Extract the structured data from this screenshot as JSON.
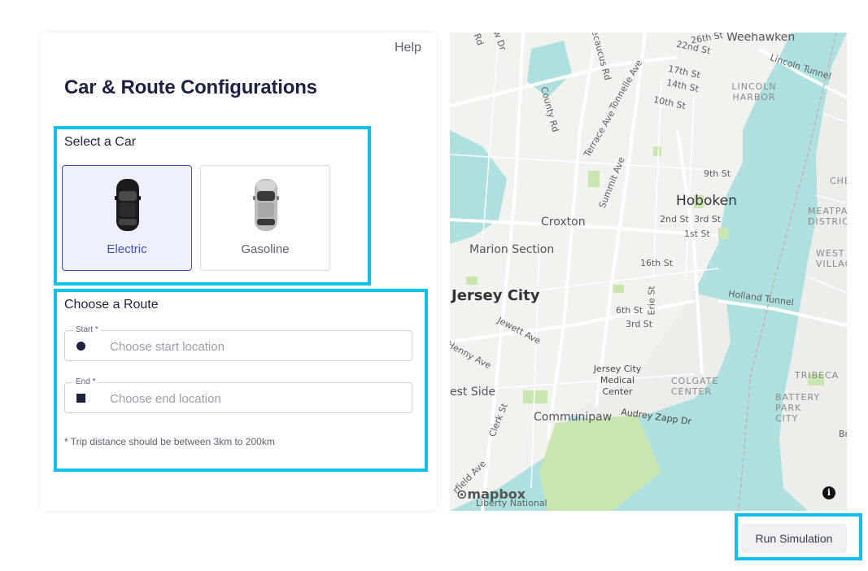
{
  "header": {
    "help_label": "Help",
    "title": "Car & Route Configurations"
  },
  "car_section": {
    "label": "Select a Car",
    "options": [
      {
        "name": "Electric",
        "selected": true
      },
      {
        "name": "Gasoline",
        "selected": false
      }
    ]
  },
  "route_section": {
    "label": "Choose a Route",
    "start": {
      "label": "Start *",
      "placeholder": "Choose start location",
      "value": ""
    },
    "end": {
      "label": "End *",
      "placeholder": "Choose end location",
      "value": ""
    },
    "note": "* Trip distance should be between 3km to 200km"
  },
  "map": {
    "labels": {
      "weehawken": "Weehawken",
      "lincoln_tunnel": "Lincoln Tunnel",
      "lincoln_harbor": "LINCOLN HARBOR",
      "hoboken": "Hoboken",
      "croxton": "Croxton",
      "marion_section": "Marion Section",
      "jersey_city": "Jersey City",
      "holland_tunnel": "Holland Tunnel",
      "meatpacking": "MEATPACKIN DISTRICT",
      "west_village": "WEST VILLAGI",
      "tribeca": "TRIBECA",
      "battery_park": "BATTERY PARK CITY",
      "colgate": "COLGATE CENTER",
      "medical_center": "Jersey City Medical Center",
      "communipaw": "Communipaw",
      "west_side": "est Side",
      "st_9th": "9th St",
      "st_2nd": "2nd St",
      "st_3rd": "3rd St",
      "st_1st": "1st St",
      "st_16th": "16th St",
      "st_6th": "6th St",
      "st_3rd_jc": "3rd St",
      "st_10th": "10th St",
      "st_14th": "14th St",
      "st_17th": "17th St",
      "st_22nd": "22nd St",
      "st_26th": "26th St",
      "summit_ave": "Summit Ave",
      "terrace_ave": "Terrace Ave",
      "tonnelle_ave": "Tonnelle Ave",
      "county_rd": "County Rd",
      "secaucus_rd": "Secaucus Rd",
      "jewett_ave": "Jewett Ave",
      "clerk_st": "Clerk St",
      "erie_st": "Erie St",
      "audrey_zapp": "Audrey Zapp Dr",
      "garfield_ave": "rfield Ave",
      "kenny_ave": "Henny Ave",
      "che": "CHE",
      "liberty": "Liberty National",
      "br": "Br",
      "rd_top": "Rd",
      "dr_top": "ew Dr"
    },
    "attribution": "mapbox",
    "info_icon": "info-icon"
  },
  "actions": {
    "run_label": "Run Simulation"
  },
  "colors": {
    "accent": "#3f51b5",
    "highlight": "#10c0ef",
    "selected_bg": "#eef1fd",
    "water": "#aee0e0",
    "park": "#c9e6b0"
  }
}
